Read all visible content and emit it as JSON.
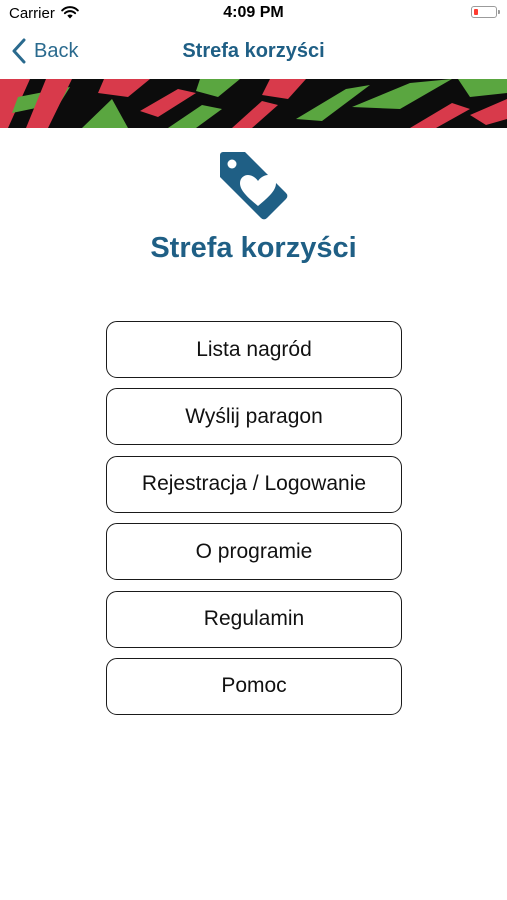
{
  "status_bar": {
    "carrier": "Carrier",
    "time": "4:09 PM"
  },
  "nav": {
    "back_label": "Back",
    "title": "Strefa korzyści"
  },
  "header": {
    "title": "Strefa korzyści",
    "icon": "heart-tag-icon"
  },
  "menu": {
    "items": [
      {
        "label": "Lista nagród"
      },
      {
        "label": "Wyślij paragon"
      },
      {
        "label": "Rejestracja / Logowanie"
      },
      {
        "label": "O programie"
      },
      {
        "label": "Regulamin"
      },
      {
        "label": "Pomoc"
      }
    ]
  },
  "colors": {
    "brand": "#1f5f85",
    "banner_black": "#0c0c0c",
    "banner_red": "#d83a4b",
    "banner_green": "#5aa640",
    "battery_low": "#ff3b30"
  }
}
